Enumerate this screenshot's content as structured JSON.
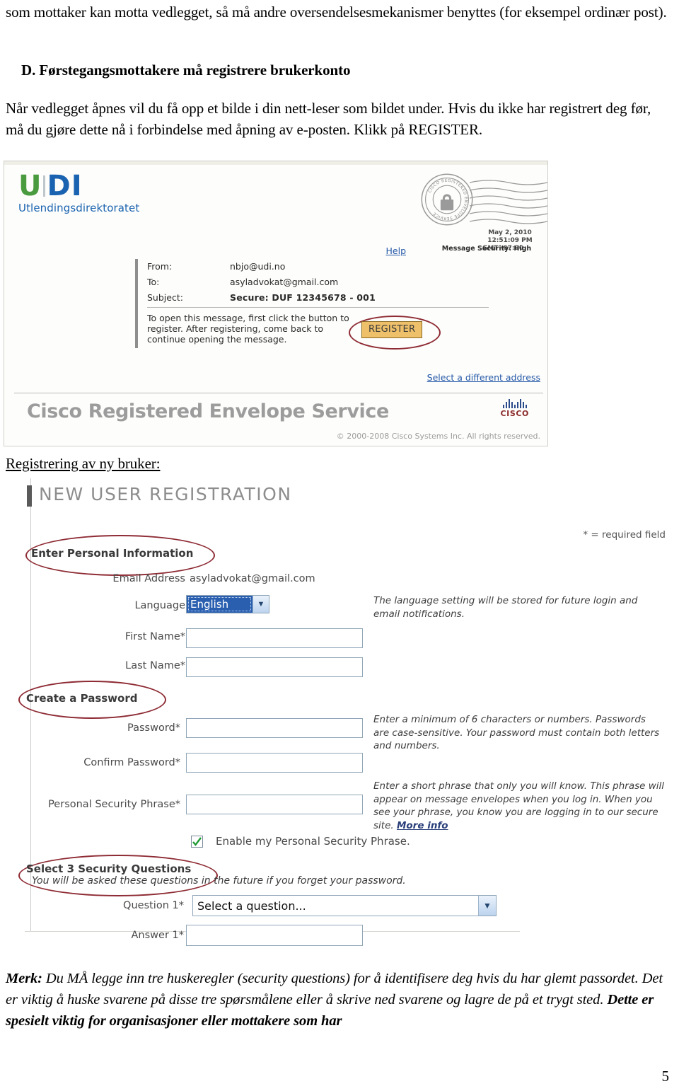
{
  "document": {
    "intro_paragraph": "som mottaker kan motta vedlegget, så må andre oversendelsesmekanismer benyttes (for eksempel ordinær post).",
    "section_heading": "D. Førstegangsmottakere må registrere brukerkonto",
    "body_paragraph": "Når vedlegget åpnes vil du få opp et bilde i din nett-leser som bildet under. Hvis du ikke har registrert deg før, må du gjøre dette nå i forbindelse med åpning av e-posten. Klikk på REGISTER.",
    "caption_registration": "Registrering av ny bruker:",
    "closing_paragraph_lead": "Merk:",
    "closing_paragraph": " Du MÅ legge inn tre huskeregler (security questions) for å identifisere deg hvis du har glemt passordet. Det er viktig å huske svarene på disse tre spørsmålene eller å skrive ned svarene og lagre de på et trygt sted. ",
    "closing_paragraph_bold_tail": "Dette er spesielt viktig for organisasjoner eller mottakere som har",
    "page_number": "5"
  },
  "envelope_screenshot": {
    "logo": {
      "mark_u": "U",
      "mark_di": "DI",
      "subtitle": "Utlendingsdirektoratet",
      "color_green": "#4a9b3f",
      "color_blue": "#1a63b0"
    },
    "postmark": {
      "ring_text": "CISCO REGISTERED ENVELOPE SERVICE",
      "date": "May 2, 2010",
      "time": "12:51:09 PM",
      "gmt": "GMT -07:00",
      "security": "Message Security: High"
    },
    "help_link": "Help",
    "message": {
      "from_label": "From:",
      "from_value": "nbjo@udi.no",
      "to_label": "To:",
      "to_value": "asyladvokat@gmail.com",
      "subject_label": "Subject:",
      "subject_value": "Secure: DUF 12345678 - 001",
      "instructions": "To open this message, first click the button to register. After registering, come back to continue opening the message.",
      "register_button": "REGISTER"
    },
    "alt_address_link": "Select a different address",
    "brand": "Cisco Registered Envelope Service",
    "cisco_word": "CISCO",
    "copyright": "© 2000-2008 Cisco Systems Inc. All rights reserved."
  },
  "registration_screenshot": {
    "title": "NEW USER REGISTRATION",
    "required_note": "* = required field",
    "sections": {
      "personal": "Enter Personal Information",
      "password": "Create a Password",
      "questions": "Select 3 Security Questions",
      "questions_sub": "You will be asked these questions in the future if you forget your password."
    },
    "fields": {
      "email_label": "Email Address",
      "email_value": "asyladvokat@gmail.com",
      "language_label": "Language",
      "language_value": "English",
      "first_name_label": "First Name*",
      "first_name_value": "",
      "last_name_label": "Last Name*",
      "last_name_value": "",
      "password_label": "Password*",
      "password_value": "",
      "confirm_password_label": "Confirm Password*",
      "confirm_password_value": "",
      "security_phrase_label": "Personal Security Phrase*",
      "security_phrase_value": "",
      "enable_phrase_label": "Enable my Personal Security Phrase.",
      "enable_phrase_checked": true,
      "question1_label": "Question 1*",
      "question1_value": "Select a question...",
      "answer1_label": "Answer 1*",
      "answer1_value": ""
    },
    "help": {
      "language": "The language setting will be stored for future login and email notifications.",
      "password": "Enter a minimum of 6 characters or numbers. Passwords are case-sensitive. Your password must contain both letters and numbers.",
      "phrase": "Enter a short phrase that only you will know. This phrase will appear on message envelopes when you log in. When you see your phrase, you know you are logging in to our secure site. ",
      "phrase_link": "More info"
    },
    "colors": {
      "annotation_red": "#8e2b34",
      "input_border": "#8fa6b8",
      "select_highlight": "#2a5fb0"
    }
  }
}
